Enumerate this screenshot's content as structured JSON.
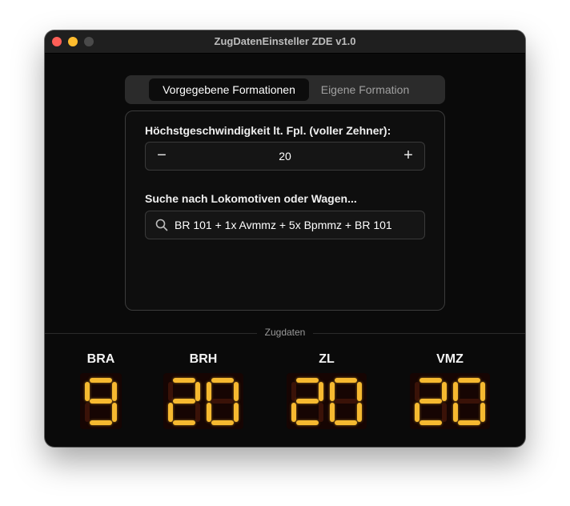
{
  "window": {
    "title": "ZugDatenEinsteller ZDE v1.0"
  },
  "tabs": [
    {
      "label": "Vorgegebene Formationen",
      "active": true
    },
    {
      "label": "Eigene Formation",
      "active": false
    }
  ],
  "speed": {
    "label": "Höchstgeschwindigkeit lt. Fpl. (voller Zehner):",
    "value": "20",
    "minus": "−",
    "plus": "+"
  },
  "search": {
    "label": "Suche nach Lokomotiven oder Wagen...",
    "value": "BR 101 + 1x Avmmz + 5x Bpmmz + BR 101"
  },
  "section": {
    "label": "Zugdaten"
  },
  "readouts": [
    {
      "name": "BRA",
      "value": "9"
    },
    {
      "name": "BRH",
      "value": "20"
    },
    {
      "name": "ZL",
      "value": "20"
    },
    {
      "name": "VMZ",
      "value": "20"
    }
  ],
  "colors": {
    "segment_on": "#f6b930",
    "segment_off": "#3a1208",
    "traffic_close": "#ff5f57",
    "traffic_minimize": "#febc2e"
  }
}
